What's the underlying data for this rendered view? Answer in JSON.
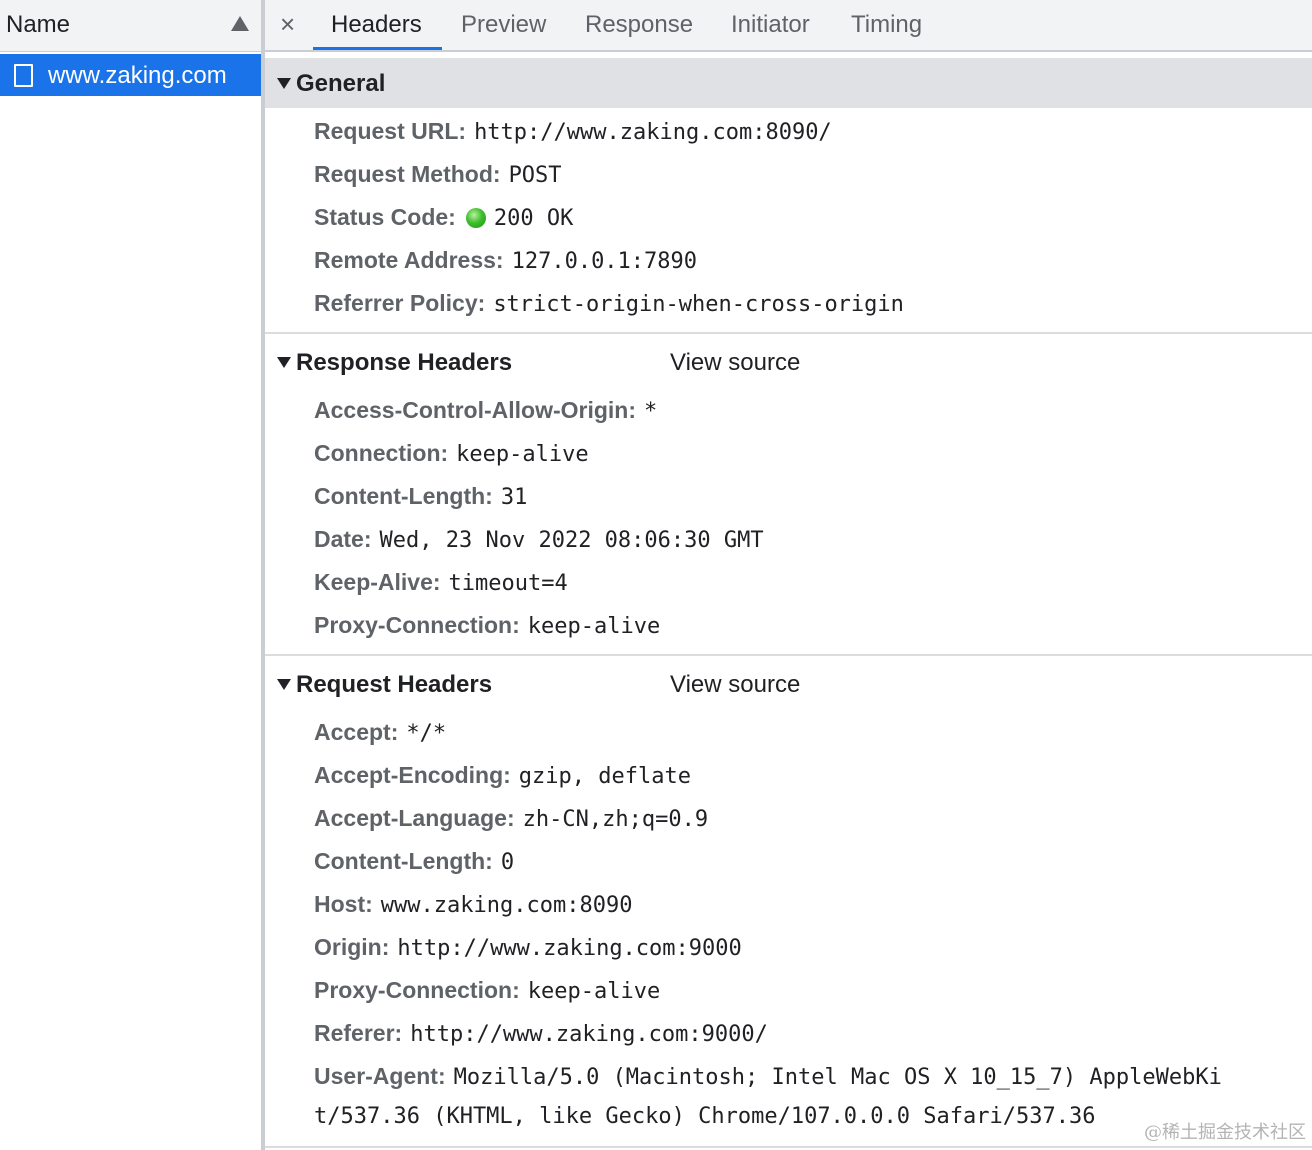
{
  "request_list": {
    "column_header": "Name",
    "selected_request": "www.zaking.com"
  },
  "tabs": [
    "Headers",
    "Preview",
    "Response",
    "Initiator",
    "Timing"
  ],
  "close_glyph": "×",
  "general": {
    "title": "General",
    "rows": [
      {
        "key": "Request URL:",
        "value": "http://www.zaking.com:8090/"
      },
      {
        "key": "Request Method:",
        "value": "POST"
      },
      {
        "key": "Status Code:",
        "value": "200 OK"
      },
      {
        "key": "Remote Address:",
        "value": "127.0.0.1:7890"
      },
      {
        "key": "Referrer Policy:",
        "value": "strict-origin-when-cross-origin"
      }
    ]
  },
  "response_headers": {
    "title": "Response Headers",
    "view_source": "View source",
    "rows": [
      {
        "key": "Access-Control-Allow-Origin:",
        "value": "*"
      },
      {
        "key": "Connection:",
        "value": "keep-alive"
      },
      {
        "key": "Content-Length:",
        "value": "31"
      },
      {
        "key": "Date:",
        "value": "Wed, 23 Nov 2022 08:06:30 GMT"
      },
      {
        "key": "Keep-Alive:",
        "value": "timeout=4"
      },
      {
        "key": "Proxy-Connection:",
        "value": "keep-alive"
      }
    ]
  },
  "request_headers": {
    "title": "Request Headers",
    "view_source": "View source",
    "rows": [
      {
        "key": "Accept:",
        "value": "*/*"
      },
      {
        "key": "Accept-Encoding:",
        "value": "gzip, deflate"
      },
      {
        "key": "Accept-Language:",
        "value": "zh-CN,zh;q=0.9"
      },
      {
        "key": "Content-Length:",
        "value": "0"
      },
      {
        "key": "Host:",
        "value": "www.zaking.com:8090"
      },
      {
        "key": "Origin:",
        "value": "http://www.zaking.com:9000"
      },
      {
        "key": "Proxy-Connection:",
        "value": "keep-alive"
      },
      {
        "key": "Referer:",
        "value": "http://www.zaking.com:9000/"
      },
      {
        "key": "User-Agent:",
        "value": "Mozilla/5.0 (Macintosh; Intel Mac OS X 10_15_7) AppleWebKi",
        "value_cont": "t/537.36 (KHTML, like Gecko) Chrome/107.0.0.0 Safari/537.36"
      }
    ]
  },
  "status_color": "#34a853",
  "accent_color": "#1a73e8",
  "watermark": "@稀土掘金技术社区"
}
